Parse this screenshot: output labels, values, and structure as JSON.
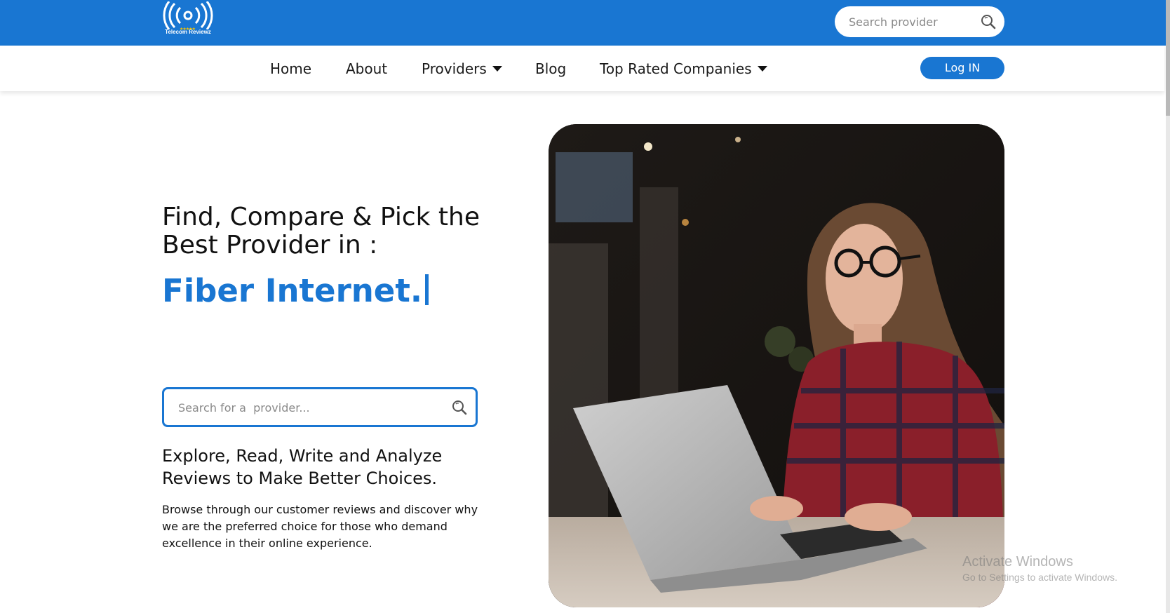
{
  "header": {
    "logo_text": "Telecom Reviewz",
    "logo_stars": "★★★★★",
    "search_placeholder": "Search provider"
  },
  "nav": {
    "items": [
      {
        "label": "Home"
      },
      {
        "label": "About"
      },
      {
        "label": "Providers"
      },
      {
        "label": "Blog"
      },
      {
        "label": "Top Rated Companies"
      }
    ],
    "login_label": "Log IN"
  },
  "hero": {
    "heading": "Find, Compare & Pick the Best Provider in :",
    "typed_text": "Fiber Internet.",
    "search_placeholder": "Search for a  provider...",
    "tagline": "Explore, Read, Write and Analyze Reviews to Make Better Choices.",
    "description": "Browse through our customer reviews and discover why we are the preferred choice for those who demand excellence in their online experience."
  },
  "watermark": {
    "title": "Activate Windows",
    "subtitle": "Go to Settings to activate Windows."
  },
  "colors": {
    "brand": "#1976d2",
    "text": "#111111",
    "placeholder": "#8a8a8a"
  },
  "icons": {
    "logo": "signal-broadcast-icon",
    "search": "search-icon",
    "dropdown": "caret-down-icon"
  }
}
